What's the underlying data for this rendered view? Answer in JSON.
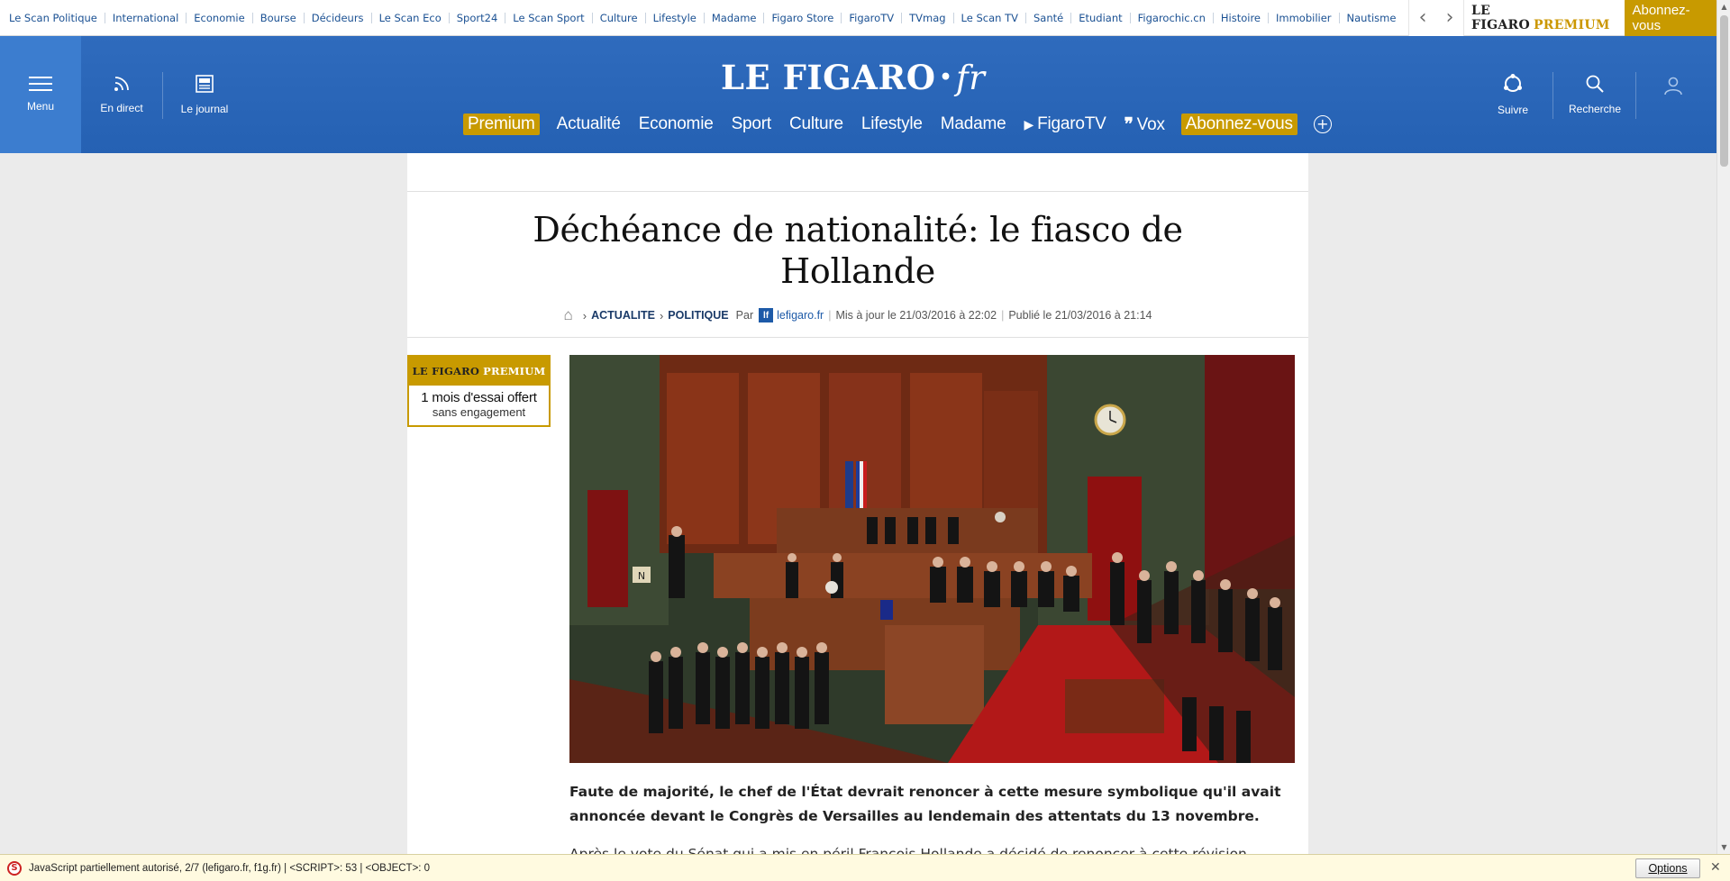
{
  "topbar": {
    "links": [
      "Le Scan Politique",
      "International",
      "Economie",
      "Bourse",
      "Décideurs",
      "Le Scan Eco",
      "Sport24",
      "Le Scan Sport",
      "Culture",
      "Lifestyle",
      "Madame",
      "Figaro Store",
      "FigaroTV",
      "TVmag",
      "Le Scan TV",
      "Santé",
      "Etudiant",
      "Figarochic.cn",
      "Histoire",
      "Immobilier",
      "Nautisme"
    ],
    "prev_arrow": "‹",
    "next_arrow": "›",
    "premium_brand": "LE FIGARO",
    "premium_word": "PREMIUM",
    "subscribe": "Abonnez-vous"
  },
  "header": {
    "menu": "Menu",
    "live": "En direct",
    "journal": "Le journal",
    "logo_main": "LE FIGARO",
    "logo_dot": "•",
    "logo_fr": "fr",
    "follow": "Suivre",
    "search": "Recherche",
    "nav": {
      "premium": "Premium",
      "actualite": "Actualité",
      "economie": "Economie",
      "sport": "Sport",
      "culture": "Culture",
      "lifestyle": "Lifestyle",
      "madame": "Madame",
      "figarotv": "FigaroTV",
      "vox": "Vox",
      "subscribe": "Abonnez-vous",
      "more": "+"
    }
  },
  "article": {
    "title": "Déchéance de nationalité: le fiasco de Hollande",
    "breadcrumb": [
      "ACTUALITE",
      "POLITIQUE"
    ],
    "by_label": "Par",
    "author_icon": "lf",
    "author": "lefigaro.fr",
    "updated": "Mis à jour le 21/03/2016 à 22:02",
    "published": "Publié le 21/03/2016 à 21:14",
    "lead": "Faute de majorité, le chef de l'État devrait renoncer à cette mesure symbolique qu'il avait annoncée devant le Congrès de Versailles au lendemain des attentats du 13 novembre.",
    "body_partial": "Après le vote du Sénat qui a mis en péril François Hollande a décidé de renoncer à cette révision"
  },
  "promo": {
    "brand": "LE FIGARO",
    "premium": "PREMIUM",
    "line1": "1 mois d'essai offert",
    "line2": "sans engagement"
  },
  "photo": {
    "clock_sign": "N"
  },
  "statusbar": {
    "icon": "S",
    "text": "JavaScript partiellement autorisé, 2/7 (lefigaro.fr, f1g.fr) | <SCRIPT>: 53 | <OBJECT>: 0",
    "options": "Options",
    "close": "✕"
  },
  "colors": {
    "header_blue": "#2a66b8",
    "menu_blue": "#3c7dcf",
    "premium_gold": "#c89a00",
    "link_blue": "#1b5193"
  }
}
